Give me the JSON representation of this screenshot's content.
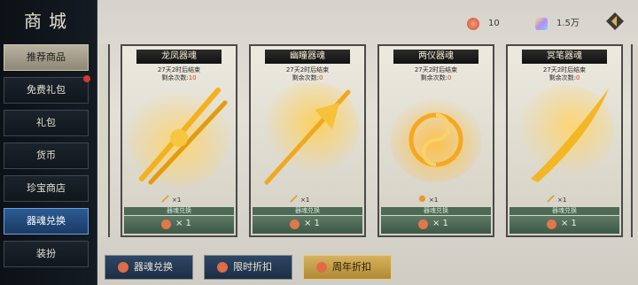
{
  "sidebar": {
    "title": "商城",
    "items": [
      {
        "label": "推荐商品"
      },
      {
        "label": "免费礼包"
      },
      {
        "label": "礼包"
      },
      {
        "label": "货币"
      },
      {
        "label": "珍宝商店"
      },
      {
        "label": "器魂兑换"
      },
      {
        "label": "装扮"
      }
    ]
  },
  "topbar": {
    "currency_1": "10",
    "currency_2": "1.5万"
  },
  "cards": [
    {
      "title": "龙凤器魂",
      "timer": "27天2时后结束",
      "remaining_label": "剩余次数:",
      "remaining": "10",
      "count": "×1",
      "strip": "器魂兑换",
      "price": "× 1"
    },
    {
      "title": "幽瞳器魂",
      "timer": "27天2时后结束",
      "remaining_label": "剩余次数:",
      "remaining": "0",
      "count": "×1",
      "strip": "器魂兑换",
      "price": "× 1"
    },
    {
      "title": "两仪器魂",
      "timer": "27天2时后结束",
      "remaining_label": "剩余次数:",
      "remaining": "0",
      "count": "×1",
      "strip": "器魂兑换",
      "price": "× 1"
    },
    {
      "title": "冥笔器魂",
      "timer": "27天2时后结束",
      "remaining_label": "剩余次数:",
      "remaining": "0",
      "count": "×1",
      "strip": "器魂兑换",
      "price": "× 1"
    }
  ],
  "tabs": [
    {
      "label": "器魂兑换"
    },
    {
      "label": "限时折扣"
    },
    {
      "label": "周年折扣"
    }
  ],
  "colors": {
    "sidebar_selected": "#2b5b93",
    "tab_active": "#d6b25e",
    "price_strip": "#4c6a55"
  }
}
